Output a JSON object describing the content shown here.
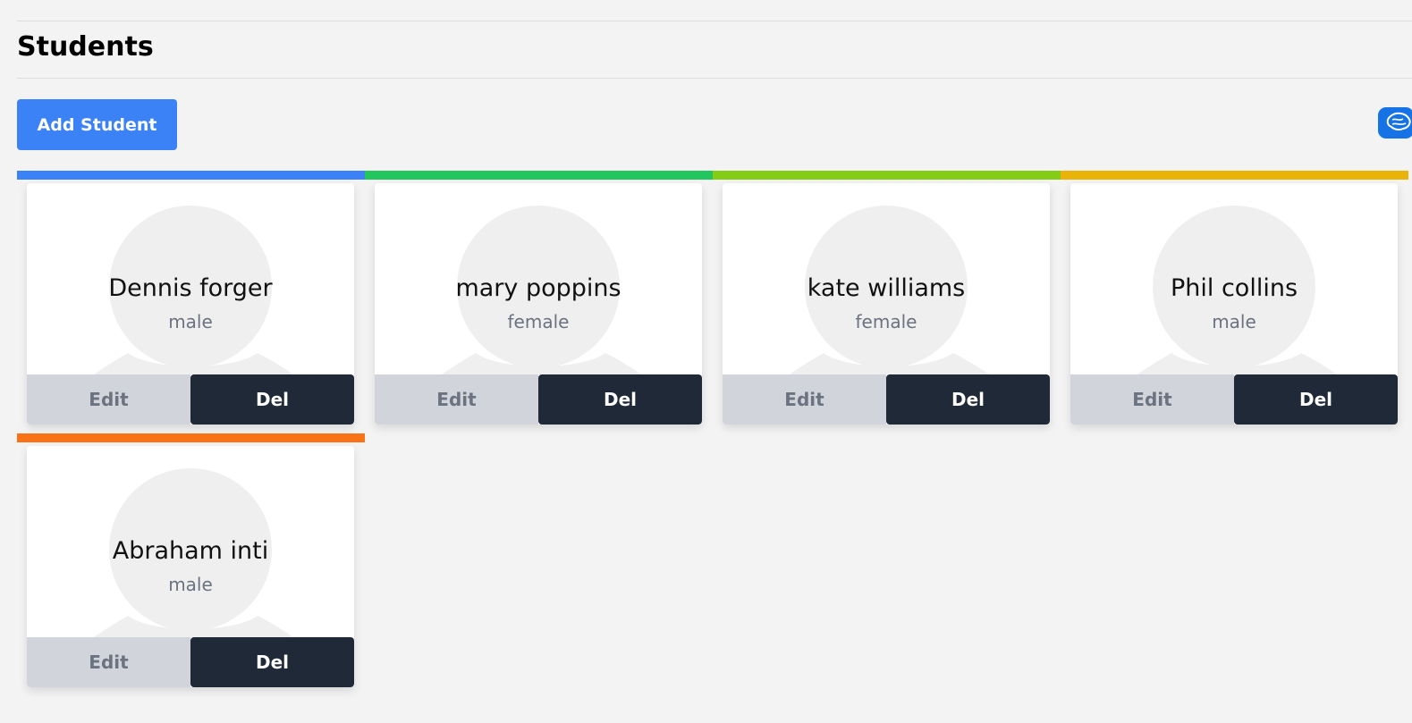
{
  "page": {
    "title": "Students",
    "add_button_label": "Add Student",
    "add_button_color": "#3b82f6",
    "background_color": "#f3f3f3"
  },
  "extension": {
    "icon": "brain-icon",
    "color": "#1673e6"
  },
  "students": [
    {
      "name": "Dennis forger",
      "gender": "male",
      "accent_color": "#3b82f6",
      "edit_label": "Edit",
      "delete_label": "Del"
    },
    {
      "name": "mary poppins",
      "gender": "female",
      "accent_color": "#22c55e",
      "edit_label": "Edit",
      "delete_label": "Del"
    },
    {
      "name": "kate williams",
      "gender": "female",
      "accent_color": "#84cc16",
      "edit_label": "Edit",
      "delete_label": "Del"
    },
    {
      "name": "Phil collins",
      "gender": "male",
      "accent_color": "#eab308",
      "edit_label": "Edit",
      "delete_label": "Del"
    },
    {
      "name": "Abraham inti",
      "gender": "male",
      "accent_color": "#f97316",
      "edit_label": "Edit",
      "delete_label": "Del"
    }
  ]
}
